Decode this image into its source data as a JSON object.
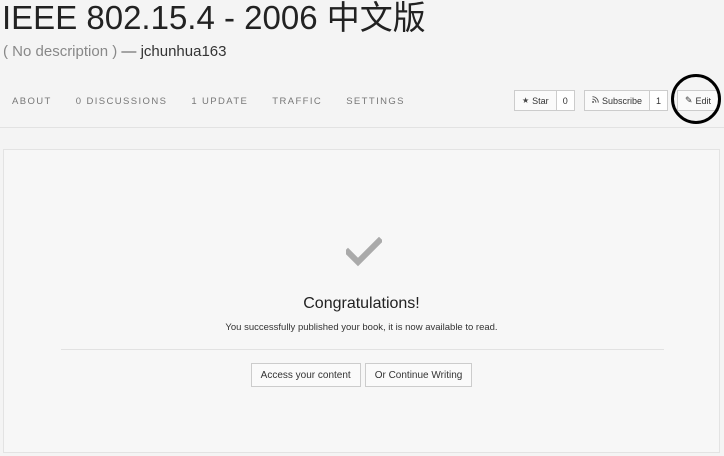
{
  "book": {
    "title": "IEEE 802.15.4 - 2006 中文版",
    "description": "( No description )",
    "separator": "—",
    "author": "jchunhua163"
  },
  "nav": {
    "items": [
      {
        "label": "ABOUT"
      },
      {
        "label": "0 DISCUSSIONS"
      },
      {
        "label": "1 UPDATE"
      },
      {
        "label": "TRAFFIC"
      },
      {
        "label": "SETTINGS"
      }
    ]
  },
  "actions": {
    "star_label": "Star",
    "star_icon": "star-icon",
    "star_count": "0",
    "subscribe_label": "Subscribe",
    "subscribe_icon": "rss-icon",
    "subscribe_count": "1",
    "edit_label": "Edit",
    "edit_icon": "pencil-icon"
  },
  "success": {
    "icon": "checkmark-icon",
    "heading": "Congratulations!",
    "message": "You successfully published your book, it is now available to read.",
    "primary_button": "Access your content",
    "secondary_button": "Or Continue Writing"
  },
  "colors": {
    "background": "#f4f4f4",
    "checkmark": "#aaaaaa",
    "annotation": "#000000"
  }
}
